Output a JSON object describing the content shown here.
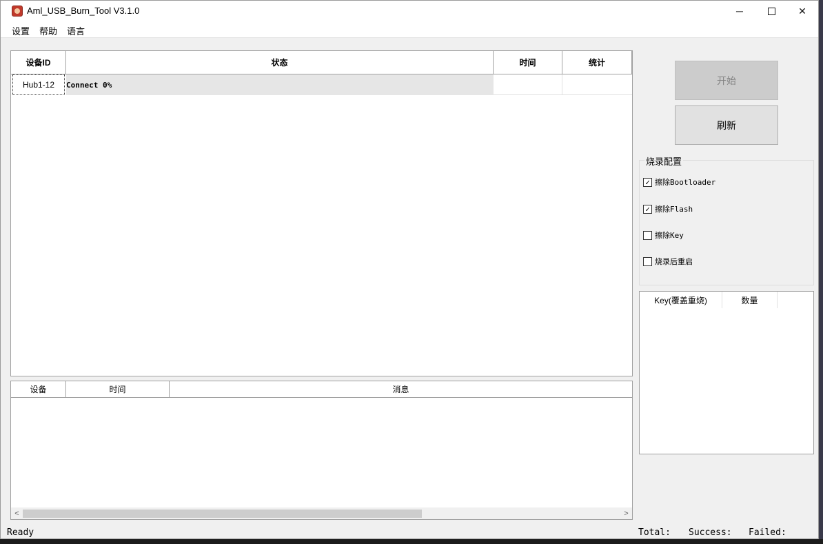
{
  "window": {
    "title": "Aml_USB_Burn_Tool V3.1.0",
    "controls": {
      "minimize": "─",
      "close": "✕"
    }
  },
  "menu": {
    "items": [
      {
        "label": "设置"
      },
      {
        "label": "帮助"
      },
      {
        "label": "语言"
      }
    ]
  },
  "device_table": {
    "headers": {
      "id": "设备ID",
      "status": "状态",
      "time": "时间",
      "stats": "统计"
    },
    "rows": [
      {
        "id": "Hub1-12",
        "status": "Connect 0%",
        "time": "",
        "stats": ""
      }
    ]
  },
  "log_table": {
    "headers": {
      "device": "设备",
      "time": "时间",
      "message": "消息"
    },
    "scroll_left": "<",
    "scroll_right": ">"
  },
  "actions": {
    "start_label": "开始",
    "refresh_label": "刷新"
  },
  "burn_config": {
    "title": "烧录配置",
    "options": [
      {
        "label": "擦除Bootloader",
        "checked": true,
        "mark": "✓"
      },
      {
        "label": "擦除Flash",
        "checked": true,
        "mark": "✓"
      },
      {
        "label": "擦除Key",
        "checked": false,
        "mark": ""
      },
      {
        "label": "烧录后重启",
        "checked": false,
        "mark": ""
      }
    ]
  },
  "key_table": {
    "headers": {
      "key": "Key(覆盖重烧)",
      "count": "数量"
    }
  },
  "status_bar": {
    "status": "Ready",
    "total": "Total:",
    "success": "Success:",
    "failed": "Failed:"
  }
}
